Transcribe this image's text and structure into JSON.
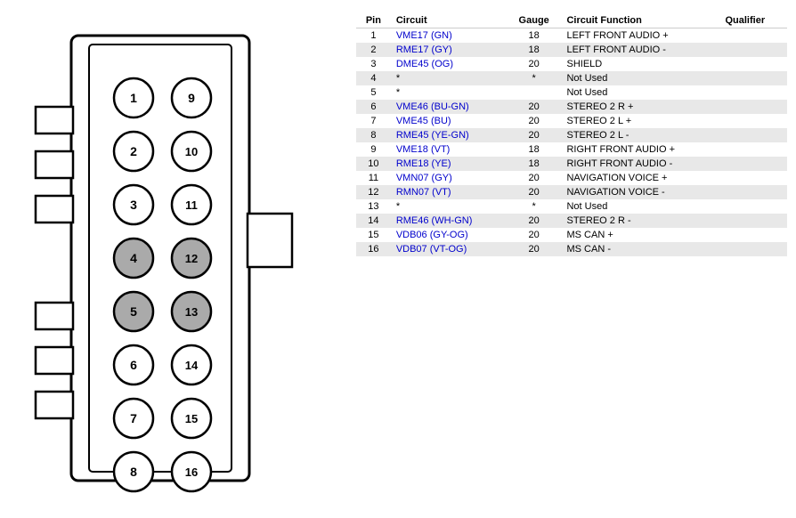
{
  "table": {
    "headers": [
      "Pin",
      "Circuit",
      "Gauge",
      "Circuit Function",
      "Qualifier"
    ],
    "rows": [
      {
        "pin": "1",
        "circuit": "VME17 (GN)",
        "gauge": "18",
        "function": "LEFT FRONT AUDIO +",
        "qualifier": ""
      },
      {
        "pin": "2",
        "circuit": "RME17 (GY)",
        "gauge": "18",
        "function": "LEFT FRONT AUDIO -",
        "qualifier": ""
      },
      {
        "pin": "3",
        "circuit": "DME45 (OG)",
        "gauge": "20",
        "function": "SHIELD",
        "qualifier": ""
      },
      {
        "pin": "4",
        "circuit": "*",
        "gauge": "*",
        "function": "Not Used",
        "qualifier": "",
        "notused": true
      },
      {
        "pin": "5",
        "circuit": "*",
        "gauge": "",
        "function": "Not Used",
        "qualifier": "",
        "notused": true
      },
      {
        "pin": "6",
        "circuit": "VME46 (BU-GN)",
        "gauge": "20",
        "function": "STEREO 2 R +",
        "qualifier": ""
      },
      {
        "pin": "7",
        "circuit": "VME45 (BU)",
        "gauge": "20",
        "function": "STEREO 2 L +",
        "qualifier": ""
      },
      {
        "pin": "8",
        "circuit": "RME45 (YE-GN)",
        "gauge": "20",
        "function": "STEREO 2 L -",
        "qualifier": ""
      },
      {
        "pin": "9",
        "circuit": "VME18 (VT)",
        "gauge": "18",
        "function": "RIGHT FRONT AUDIO +",
        "qualifier": ""
      },
      {
        "pin": "10",
        "circuit": "RME18 (YE)",
        "gauge": "18",
        "function": "RIGHT FRONT AUDIO -",
        "qualifier": ""
      },
      {
        "pin": "11",
        "circuit": "VMN07 (GY)",
        "gauge": "20",
        "function": "NAVIGATION VOICE +",
        "qualifier": ""
      },
      {
        "pin": "12",
        "circuit": "RMN07 (VT)",
        "gauge": "20",
        "function": "NAVIGATION VOICE -",
        "qualifier": ""
      },
      {
        "pin": "13",
        "circuit": "*",
        "gauge": "*",
        "function": "Not Used",
        "qualifier": "",
        "notused": true
      },
      {
        "pin": "14",
        "circuit": "RME46 (WH-GN)",
        "gauge": "20",
        "function": "STEREO 2 R -",
        "qualifier": ""
      },
      {
        "pin": "15",
        "circuit": "VDB06 (GY-OG)",
        "gauge": "20",
        "function": "MS CAN +",
        "qualifier": ""
      },
      {
        "pin": "16",
        "circuit": "VDB07 (VT-OG)",
        "gauge": "20",
        "function": "MS CAN -",
        "qualifier": ""
      }
    ]
  },
  "pins": {
    "left_column": [
      1,
      2,
      3,
      4,
      5,
      6,
      7,
      8
    ],
    "right_column": [
      9,
      10,
      11,
      12,
      13,
      14,
      15,
      16
    ],
    "gray_pins": [
      4,
      5,
      12,
      13
    ]
  }
}
